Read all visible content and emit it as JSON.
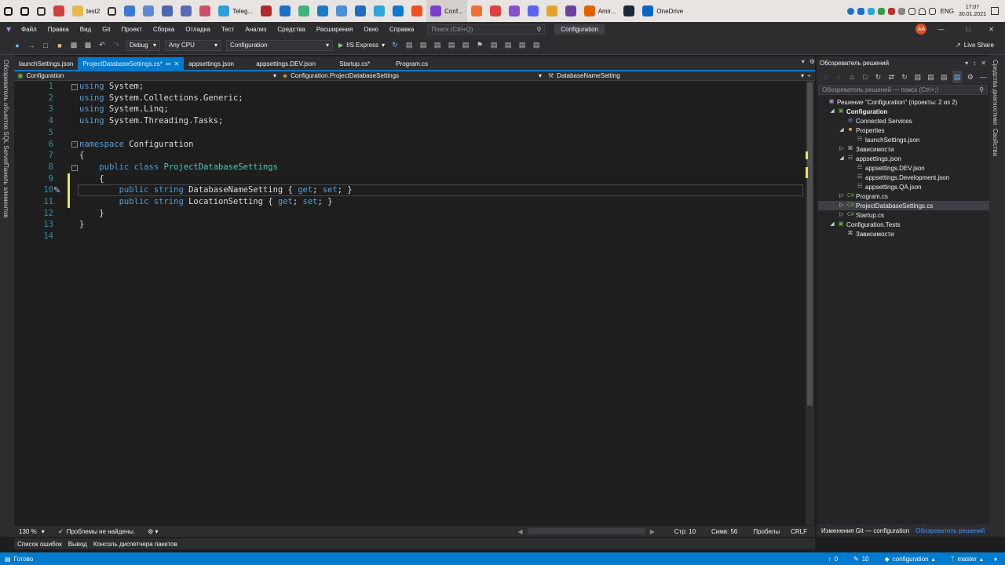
{
  "taskbar": {
    "apps": [
      {
        "label": "",
        "icon": "windows-icon",
        "color": "#111111"
      },
      {
        "label": "",
        "icon": "search-icon",
        "color": "#111111"
      },
      {
        "label": "",
        "icon": "task-view-icon",
        "color": "#333333"
      },
      {
        "label": "",
        "icon": "taskbar-app-icon",
        "color": "#d04040"
      },
      {
        "label": "test2",
        "icon": "folder-icon",
        "color": "#e8b84a"
      },
      {
        "label": "",
        "icon": "gear-icon",
        "color": "#333333"
      },
      {
        "label": "",
        "icon": "taskbar-app-icon",
        "color": "#3c78d8"
      },
      {
        "label": "",
        "icon": "taskbar-app-icon",
        "color": "#5b8ad6"
      },
      {
        "label": "",
        "icon": "taskbar-app-icon",
        "color": "#4a66b0"
      },
      {
        "label": "",
        "icon": "taskbar-app-icon",
        "color": "#5a6ab8"
      },
      {
        "label": "",
        "icon": "taskbar-app-icon",
        "color": "#d04d6a"
      },
      {
        "label": "Teleg...",
        "icon": "telegram-icon",
        "color": "#2aa0da"
      },
      {
        "label": "",
        "icon": "taskbar-app-icon",
        "color": "#b02a2a"
      },
      {
        "label": "",
        "icon": "mail-icon",
        "color": "#1a6fc9"
      },
      {
        "label": "",
        "icon": "taskbar-app-icon",
        "color": "#3fb27f"
      },
      {
        "label": "",
        "icon": "edge-icon",
        "color": "#1a7cc7"
      },
      {
        "label": "",
        "icon": "taskbar-app-icon",
        "color": "#4a90d9"
      },
      {
        "label": "",
        "icon": "taskbar-app-icon",
        "color": "#1b6ec2"
      },
      {
        "label": "",
        "icon": "taskbar-app-icon",
        "color": "#2aa6e0"
      },
      {
        "label": "",
        "icon": "vscode-icon",
        "color": "#0e7ad3"
      },
      {
        "label": "",
        "icon": "figma-icon",
        "color": "#f24e1e"
      },
      {
        "label": "Conf...",
        "icon": "visual-studio-icon",
        "color": "#7b3fcf"
      },
      {
        "label": "",
        "icon": "taskbar-app-icon",
        "color": "#f07030"
      },
      {
        "label": "",
        "icon": "taskbar-app-icon",
        "color": "#e04040"
      },
      {
        "label": "",
        "icon": "taskbar-app-icon",
        "color": "#8a4fd0"
      },
      {
        "label": "",
        "icon": "discord-icon",
        "color": "#5865f2"
      },
      {
        "label": "",
        "icon": "chrome-icon",
        "color": "#e3a32a"
      },
      {
        "label": "",
        "icon": "taskbar-app-icon",
        "color": "#7040a0"
      },
      {
        "label": "Amir...",
        "icon": "firefox-icon",
        "color": "#e66000"
      },
      {
        "label": "",
        "icon": "steam-icon",
        "color": "#1b2838"
      },
      {
        "label": "OneDrive",
        "icon": "onedrive-icon",
        "color": "#0a64c8"
      }
    ],
    "tray_lang": "ENG",
    "time": "17:07",
    "date": "30.01.2021"
  },
  "menu": {
    "items": [
      "Файл",
      "Правка",
      "Вид",
      "Git",
      "Проект",
      "Сборка",
      "Отладка",
      "Тест",
      "Анализ",
      "Средства",
      "Расширения",
      "Окно",
      "Справка"
    ],
    "search_placeholder": "Поиск (Ctrl+Q)",
    "solution_title": "Configuration",
    "user_initials": "AA",
    "live_share": "Live Share"
  },
  "toolbar": {
    "config": "Debug",
    "platform": "Any CPU",
    "project": "Configuration",
    "run_label": "IIS Express"
  },
  "left_tabs": [
    "Обозреватель объектов SQL Server",
    "Панель элементов"
  ],
  "doc_tabs": [
    {
      "label": "launchSettings.json",
      "active": false
    },
    {
      "label": "ProjectDatabaseSettings.cs*",
      "active": true
    },
    {
      "label": "appsettings.json",
      "active": false
    },
    {
      "label": "appsettings.DEV.json",
      "active": false
    },
    {
      "label": "Startup.cs*",
      "active": false
    },
    {
      "label": "Program.cs",
      "active": false
    }
  ],
  "nav": {
    "project": "Configuration",
    "type": "Configuration.ProjectDatabaseSettings",
    "member": "DatabaseNameSetting"
  },
  "code": {
    "line_numbers": [
      "1",
      "2",
      "3",
      "4",
      "5",
      "6",
      "7",
      "8",
      "9",
      "10",
      "11",
      "12",
      "13",
      "14"
    ],
    "lines": [
      "using System;",
      "using System.Collections.Generic;",
      "using System.Linq;",
      "using System.Threading.Tasks;",
      "",
      "namespace Configuration",
      "{",
      "    public class ProjectDatabaseSettings",
      "    {",
      "        public string DatabaseNameSetting { get; set; }",
      "        public string LocationSetting { get; set; }",
      "    }",
      "}",
      ""
    ]
  },
  "editor_status": {
    "zoom": "130 %",
    "issues": "Проблемы не найдены.",
    "line": "Стр: 10",
    "col": "Симв: 56",
    "spaces": "Пробелы",
    "eol": "CRLF"
  },
  "bottom_tabs": [
    "Список ошибок",
    "Вывод",
    "Консоль диспетчера пакетов"
  ],
  "solution": {
    "title": "Обозреватель решений",
    "search_placeholder": "Обозреватель решений — поиск (Ctrl+;)",
    "tree": [
      {
        "label": "Решение \"Configuration\" (проекты: 2 из 2)",
        "indent": 0,
        "icon": "solution-icon",
        "sel": false
      },
      {
        "label": "Configuration",
        "indent": 1,
        "icon": "project-icon",
        "sel": false,
        "bold": true
      },
      {
        "label": "Connected Services",
        "indent": 2,
        "icon": "connected-services-icon",
        "sel": false
      },
      {
        "label": "Properties",
        "indent": 2,
        "icon": "folder-icon",
        "sel": false
      },
      {
        "label": "launchSettings.json",
        "indent": 3,
        "icon": "json-file-icon",
        "sel": false
      },
      {
        "label": "Зависимости",
        "indent": 2,
        "icon": "dependencies-icon",
        "sel": false
      },
      {
        "label": "appsettings.json",
        "indent": 2,
        "icon": "json-file-icon",
        "sel": false
      },
      {
        "label": "appsettings.DEV.json",
        "indent": 3,
        "icon": "json-file-icon",
        "sel": false
      },
      {
        "label": "appsettings.Development.json",
        "indent": 3,
        "icon": "json-file-icon",
        "sel": false
      },
      {
        "label": "appsettings.QA.json",
        "indent": 3,
        "icon": "json-file-icon",
        "sel": false
      },
      {
        "label": "Program.cs",
        "indent": 2,
        "icon": "csharp-file-icon",
        "sel": false
      },
      {
        "label": "ProjectDatabaseSettings.cs",
        "indent": 2,
        "icon": "csharp-file-icon",
        "sel": true
      },
      {
        "label": "Startup.cs",
        "indent": 2,
        "icon": "csharp-file-icon",
        "sel": false
      },
      {
        "label": "Configuration.Tests",
        "indent": 1,
        "icon": "test-project-icon",
        "sel": false
      },
      {
        "label": "Зависимости",
        "indent": 2,
        "icon": "dependencies-icon",
        "sel": false
      }
    ],
    "bottom_tabs": [
      "Изменения Git — configuration",
      "Обозреватель решений"
    ]
  },
  "right_tabs": [
    "Средства диагностики",
    "Свойства"
  ],
  "status": {
    "ready": "Готово",
    "up_count": "0",
    "edits": "10",
    "repo": "configuration",
    "branch": "master"
  }
}
